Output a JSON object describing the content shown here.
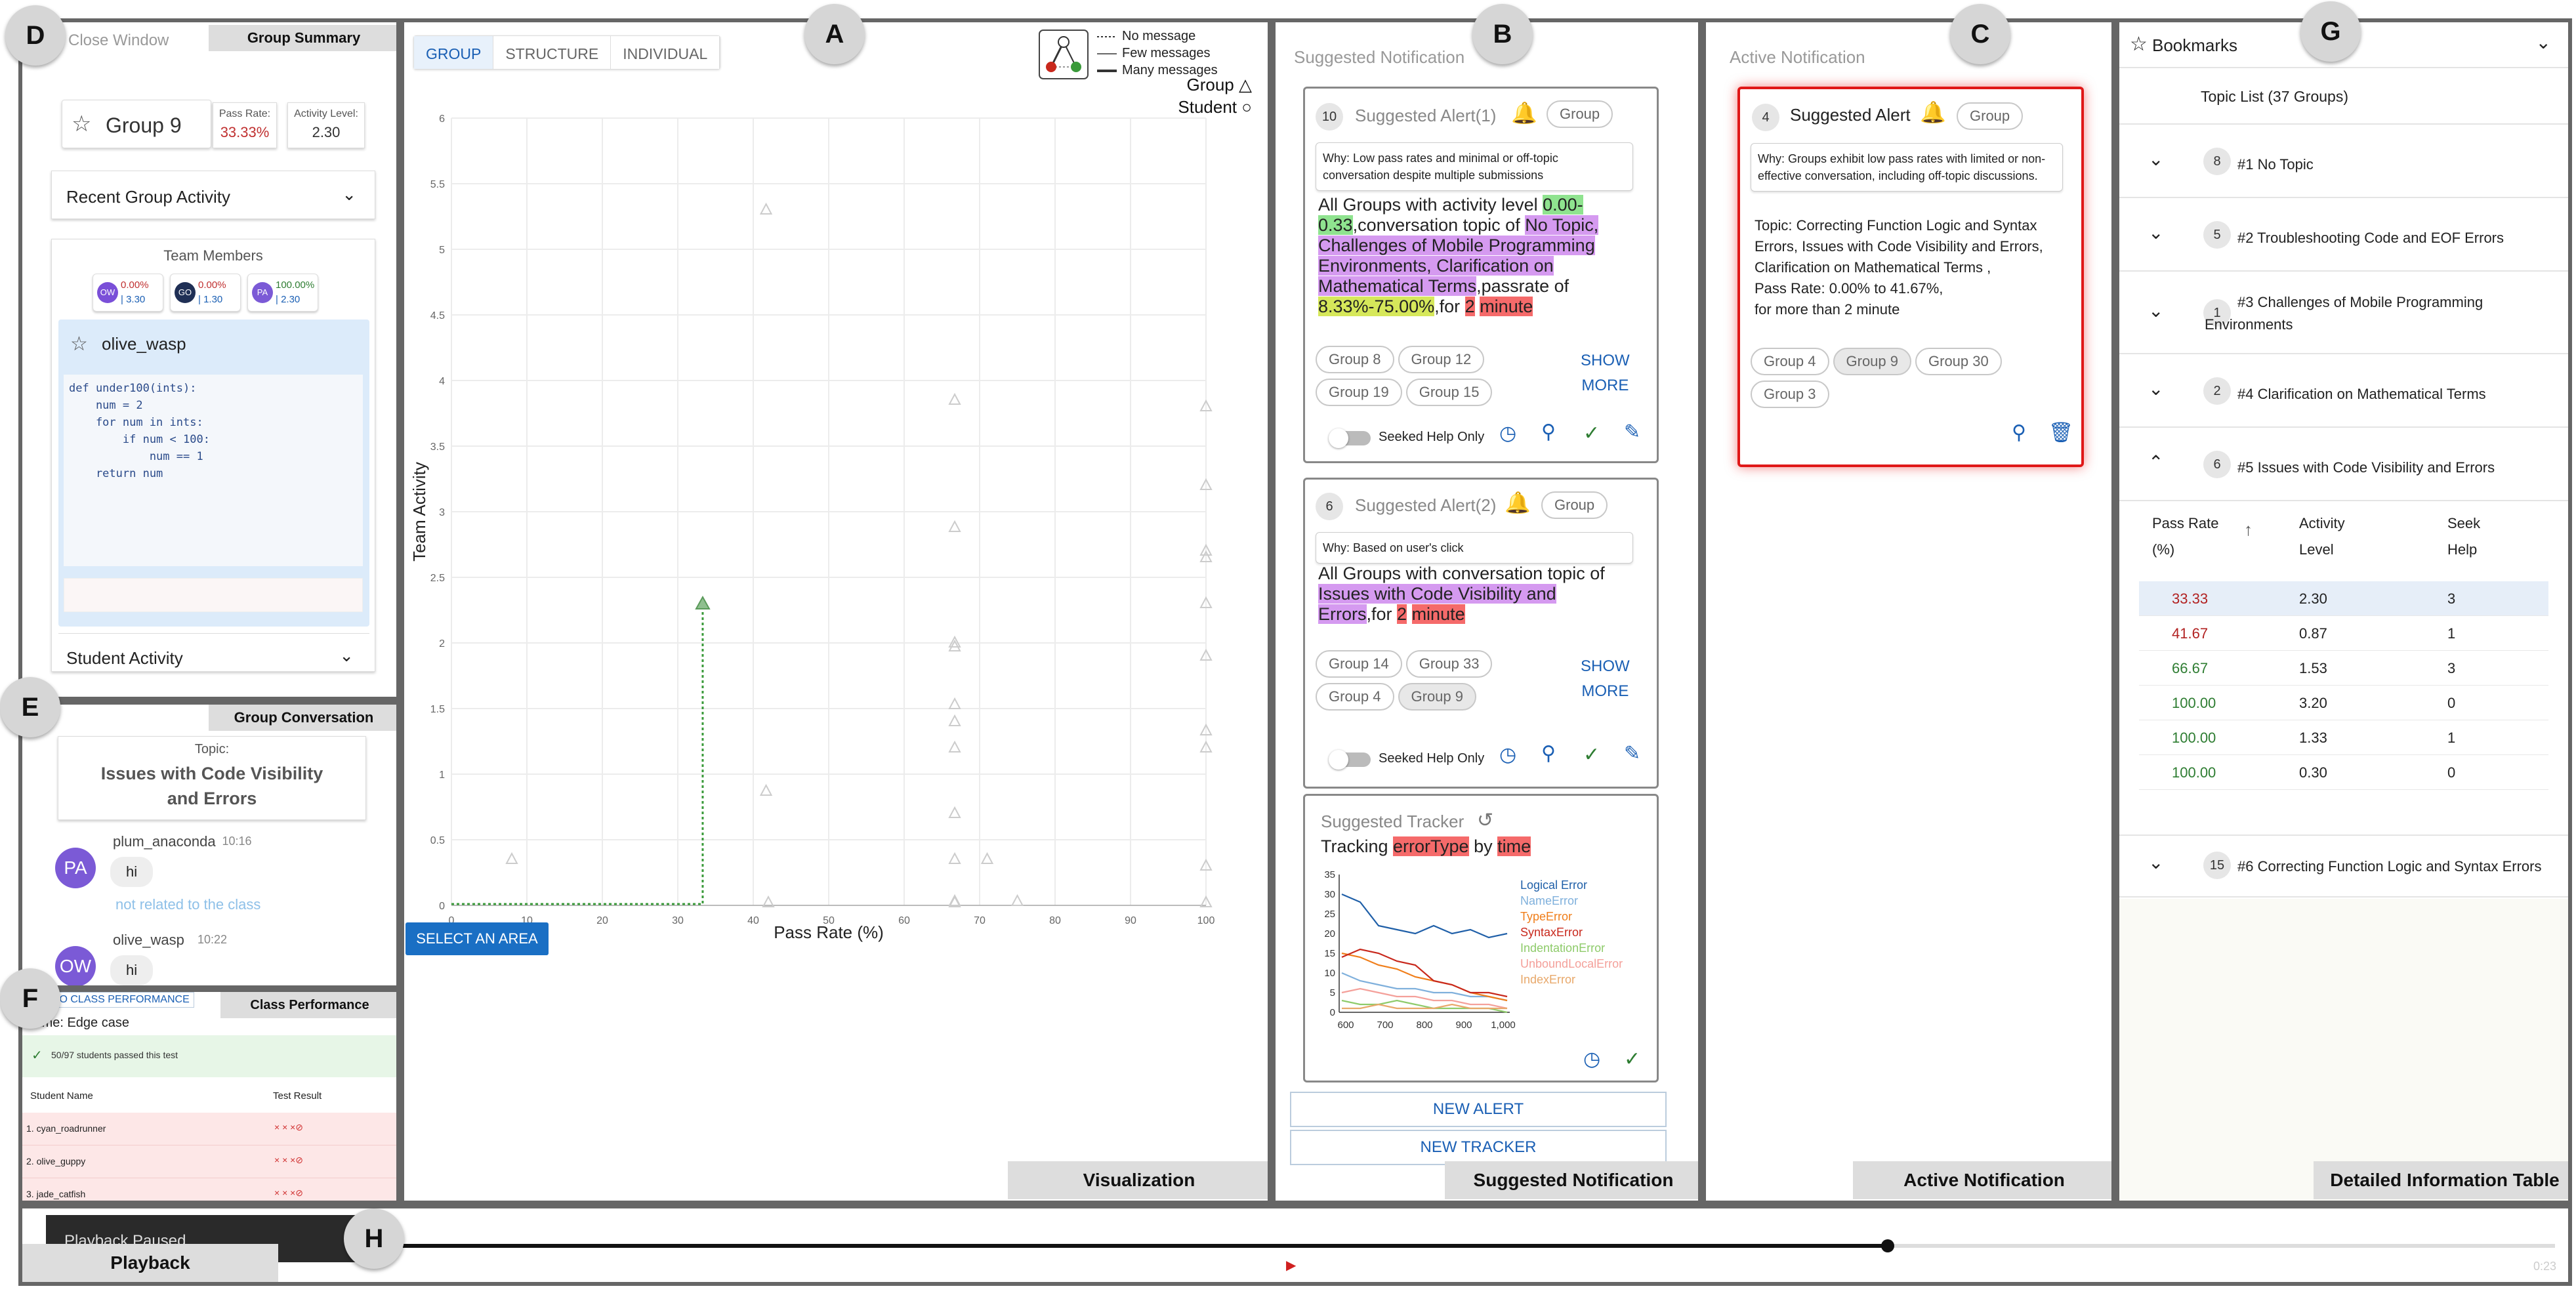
{
  "letters": {
    "a": "A",
    "b": "B",
    "c": "C",
    "d": "D",
    "e": "E",
    "f": "F",
    "g": "G",
    "h": "H"
  },
  "panel_d": {
    "close": "Close Window",
    "tab": "Group Summary",
    "group": "Group 9",
    "pass_label": "Pass Rate:",
    "pass_value": "33.33%",
    "activity_label": "Activity Level:",
    "activity_value": "2.30",
    "recent": "Recent Group Activity",
    "team": "Team Members",
    "members": [
      {
        "init": "OW",
        "top": "0.00%",
        "bot": "| 3.30",
        "color": "#7a4fd8"
      },
      {
        "init": "GO",
        "top": "0.00%",
        "bot": "| 1.30",
        "color": "#1f2f55"
      },
      {
        "init": "PA",
        "top": "100.00%",
        "bot": "| 2.30",
        "color": "#7b5ad6"
      }
    ],
    "student": "olive_wasp",
    "code": [
      "def under100(ints):",
      "    num = 2",
      "    for num in ints:",
      "        if num < 100:",
      "            num == 1",
      "    return num"
    ],
    "student_activity": "Student Activity"
  },
  "panel_e": {
    "tab": "Group Conversation",
    "topic_label": "Topic:",
    "topic": "Issues with Code Visibility and Errors",
    "messages": [
      {
        "init": "PA",
        "user": "plum_anaconda",
        "time": "10:16",
        "text": "hi",
        "note": "not related to the class"
      },
      {
        "init": "OW",
        "user": "olive_wasp",
        "time": "10:22",
        "text": "hi",
        "note": ""
      }
    ]
  },
  "panel_f": {
    "link": "TO CLASS PERFORMANCE",
    "tab": "Class Performance",
    "name": "Name: Edge case",
    "passed": "50/97 students passed this test",
    "col1": "Student Name",
    "col2": "Test Result",
    "rows": [
      {
        "name": "1. cyan_roadrunner",
        "res": "× × ×⊘"
      },
      {
        "name": "2. olive_guppy",
        "res": "× × ×⊘"
      },
      {
        "name": "3. jade_catfish",
        "res": "× × ×⊘"
      }
    ]
  },
  "panel_a": {
    "tabs": [
      "GROUP",
      "STRUCTURE",
      "INDIVIDUAL"
    ],
    "legend": [
      "No message",
      "Few messages",
      "Many messages"
    ],
    "shape_group": "Group",
    "shape_student": "Student",
    "select": "SELECT AN AREA",
    "tag": "Visualization"
  },
  "chart_data": {
    "type": "scatter",
    "xlabel": "Pass Rate (%)",
    "ylabel": "Team Activity",
    "xlim": [
      0,
      100
    ],
    "ylim": [
      0,
      6
    ],
    "xticks": [
      0,
      10,
      20,
      30,
      40,
      50,
      60,
      70,
      80,
      90,
      100
    ],
    "yticks": [
      0,
      0.5,
      1,
      1.5,
      2,
      2.5,
      3,
      3.5,
      4,
      4.5,
      5,
      5.5,
      6
    ],
    "points": [
      [
        8,
        0.35
      ],
      [
        33.3,
        2.3
      ],
      [
        41.7,
        5.3
      ],
      [
        41.7,
        0.87
      ],
      [
        42,
        0.02
      ],
      [
        66.7,
        3.85
      ],
      [
        66.7,
        2.88
      ],
      [
        66.7,
        2.0
      ],
      [
        66.7,
        1.97
      ],
      [
        66.7,
        1.53
      ],
      [
        66.7,
        1.4
      ],
      [
        66.7,
        1.2
      ],
      [
        66.7,
        0.7
      ],
      [
        66.7,
        0.35
      ],
      [
        66.7,
        0.03
      ],
      [
        66.7,
        0.02
      ],
      [
        71,
        0.35
      ],
      [
        75,
        0.03
      ],
      [
        100,
        3.8
      ],
      [
        100,
        3.2
      ],
      [
        100,
        2.7
      ],
      [
        100,
        2.65
      ],
      [
        100,
        2.3
      ],
      [
        100,
        1.9
      ],
      [
        100,
        1.33
      ],
      [
        100,
        1.2
      ],
      [
        100,
        0.3
      ],
      [
        100,
        0.02
      ]
    ],
    "highlight": [
      33.3,
      2.3
    ]
  },
  "panel_b": {
    "header": "Suggested Notification",
    "tag": "Suggested Notification",
    "alert1": {
      "count": "10",
      "title": "Suggested Alert(1)",
      "chip": "Group",
      "why": "Why: Low pass rates and minimal or off-topic conversation despite multiple submissions",
      "t1": "All Groups with activity level ",
      "h1": "0.00-0.33",
      "t2": ",conversation topic of ",
      "h2": "No Topic, Challenges of Mobile Programming Environments, Clarification on Mathematical Terms",
      "t3": ",passrate of ",
      "h3": "8.33%-75.00%",
      "t4": ",for ",
      "h4": "2",
      "t5": " ",
      "h5": "minute",
      "groups": [
        "Group 8",
        "Group 12",
        "Group 19",
        "Group 15"
      ],
      "more1": "SHOW",
      "more2": "MORE",
      "seek": "Seeked Help Only"
    },
    "alert2": {
      "count": "6",
      "title": "Suggested Alert(2)",
      "chip": "Group",
      "why": "Why: Based on user's click",
      "t1": "All Groups with conversation topic of ",
      "h1": "Issues with Code Visibility and Errors",
      "t2": ",for ",
      "h2": "2",
      "t3": " ",
      "h3": "minute",
      "groups": [
        "Group 14",
        "Group 33",
        "Group 4",
        "Group 9"
      ],
      "more1": "SHOW",
      "more2": "MORE",
      "seek": "Seeked Help Only"
    },
    "tracker": {
      "title": "Suggested Tracker",
      "t1": "Tracking ",
      "h1": "errorType",
      "t2": " by ",
      "h2": "time",
      "legend": [
        {
          "name": "Logical Error",
          "color": "#1f5fa8"
        },
        {
          "name": "NameError",
          "color": "#7fb0dc"
        },
        {
          "name": "TypeError",
          "color": "#f07e1a"
        },
        {
          "name": "SyntaxError",
          "color": "#c8281c"
        },
        {
          "name": "IndentationError",
          "color": "#8ecb6a"
        },
        {
          "name": "UnboundLocalError",
          "color": "#f4a09a"
        },
        {
          "name": "IndexError",
          "color": "#e8a86a"
        }
      ],
      "xticks": [
        "600",
        "700",
        "800",
        "900",
        "1,000"
      ],
      "yticks": [
        "0",
        "5",
        "10",
        "15",
        "20",
        "25",
        "30",
        "35"
      ]
    },
    "new_alert": "NEW ALERT",
    "new_tracker": "NEW TRACKER"
  },
  "panel_c": {
    "header": "Active Notification",
    "tag": "Active Notification",
    "count": "4",
    "title": "Suggested Alert",
    "chip": "Group",
    "why": "Why: Groups exhibit low pass rates with limited or non-effective conversation, including off-topic discussions.",
    "lines": [
      "Topic: Correcting Function Logic and Syntax",
      "Errors, Issues with Code Visibility and Errors,",
      "Clarification on Mathematical Terms ,",
      "Pass Rate: 0.00% to 41.67%,",
      "for more than 2 minute"
    ],
    "groups": [
      "Group 4",
      "Group 9",
      "Group 30",
      "Group 3"
    ]
  },
  "panel_g": {
    "header": "Bookmarks",
    "topic_list": "Topic List (37 Groups)",
    "topics": [
      {
        "n": "8",
        "label": "#1 No Topic"
      },
      {
        "n": "5",
        "label": "#2 Troubleshooting Code and EOF Errors"
      },
      {
        "n": "1",
        "label": "#3 Challenges of Mobile Programming",
        "label2": "Environments"
      },
      {
        "n": "2",
        "label": "#4 Clarification on Mathematical Terms"
      },
      {
        "n": "6",
        "label": "#5 Issues with Code Visibility and Errors"
      }
    ],
    "cols": [
      "Pass Rate",
      "(%)",
      "Activity",
      "Level",
      "Seek",
      "Help"
    ],
    "rows": [
      {
        "p": "33.33",
        "a": "2.30",
        "s": "3",
        "c": "#b22222"
      },
      {
        "p": "41.67",
        "a": "0.87",
        "s": "1",
        "c": "#b22222"
      },
      {
        "p": "66.67",
        "a": "1.53",
        "s": "3",
        "c": "#2e7d32"
      },
      {
        "p": "100.00",
        "a": "3.20",
        "s": "0",
        "c": "#2e7d32"
      },
      {
        "p": "100.00",
        "a": "1.33",
        "s": "1",
        "c": "#2e7d32"
      },
      {
        "p": "100.00",
        "a": "0.30",
        "s": "0",
        "c": "#2e7d32"
      }
    ],
    "last": {
      "n": "15",
      "label": "#6 Correcting Function Logic and Syntax Errors"
    },
    "tag": "Detailed Information Table"
  },
  "panel_h": {
    "paused": "Playback Paused",
    "tag": "Playback",
    "time": "0:23",
    "progress": 0.69
  }
}
